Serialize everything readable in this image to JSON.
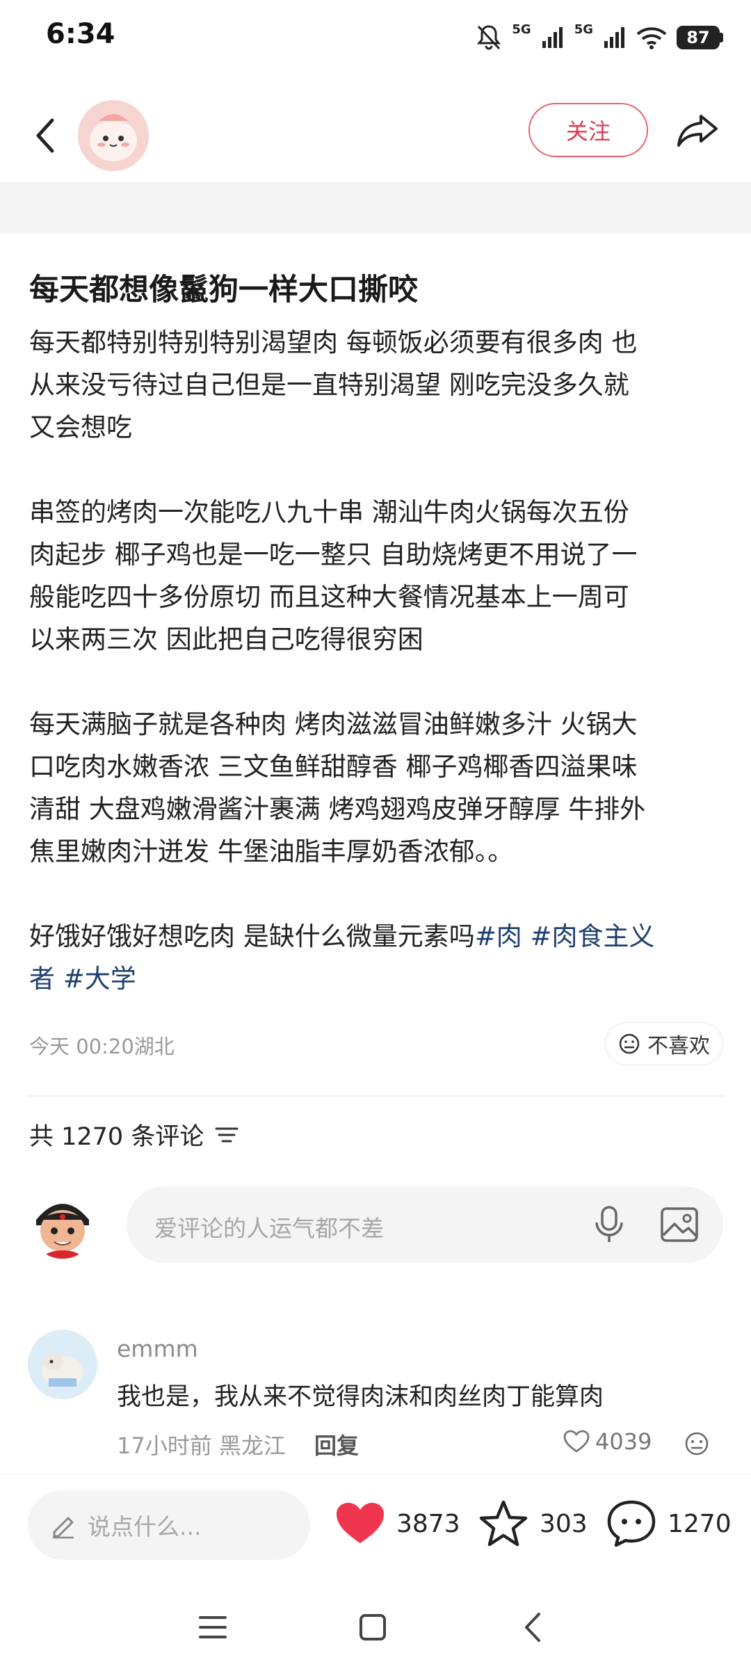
{
  "status": {
    "time": "6:34",
    "net1": "5G",
    "net2": "5G",
    "battery": "87"
  },
  "header": {
    "follow_label": "关注"
  },
  "post": {
    "title": "每天都想像鬣狗一样大口撕咬",
    "lines": [
      "每天都特别特别特别渴望肉 每顿饭必须要有很多肉 也",
      "从来没亏待过自己但是一直特别渴望 刚吃完没多久就",
      "又会想吃",
      "串签的烤肉一次能吃八九十串 潮汕牛肉火锅每次五份",
      "肉起步 椰子鸡也是一吃一整只 自助烧烤更不用说了一",
      "般能吃四十多份原切 而且这种大餐情况基本上一周可",
      "以来两三次 因此把自己吃得很穷困",
      "每天满脑子就是各种肉 烤肉滋滋冒油鲜嫩多汁 火锅大",
      "口吃肉水嫩香浓 三文鱼鲜甜醇香 椰子鸡椰香四溢果味",
      "清甜 大盘鸡嫩滑酱汁裹满 烤鸡翅鸡皮弹牙醇厚 牛排外",
      "焦里嫩肉汁迸发 牛堡油脂丰厚奶香浓郁。。"
    ],
    "last_line_text": "好饿好饿好想吃肉 是缺什么微量元素吗",
    "tag1": "#肉",
    "tag2": "#肉食主义",
    "tag2_cont": "者",
    "tag3": "#大学",
    "time_location": "今天 00:20湖北",
    "dislike_label": "不喜欢"
  },
  "comments_header": {
    "count_label": "共 1270 条评论"
  },
  "comment_input": {
    "placeholder": "爱评论的人运气都不差"
  },
  "comment": {
    "user": "emmm",
    "text": "我也是，我从来不觉得肉沫和肉丝肉丁能算肉",
    "meta": "17小时前 黑龙江",
    "reply_label": "回复",
    "likes": "4039"
  },
  "bottom": {
    "say_placeholder": "说点什么...",
    "like_count": "3873",
    "fav_count": "303",
    "comment_count": "1270"
  },
  "colors": {
    "accent": "#e23a4f",
    "hashtag": "#1e3f6e",
    "like_red": "#f0354e"
  }
}
